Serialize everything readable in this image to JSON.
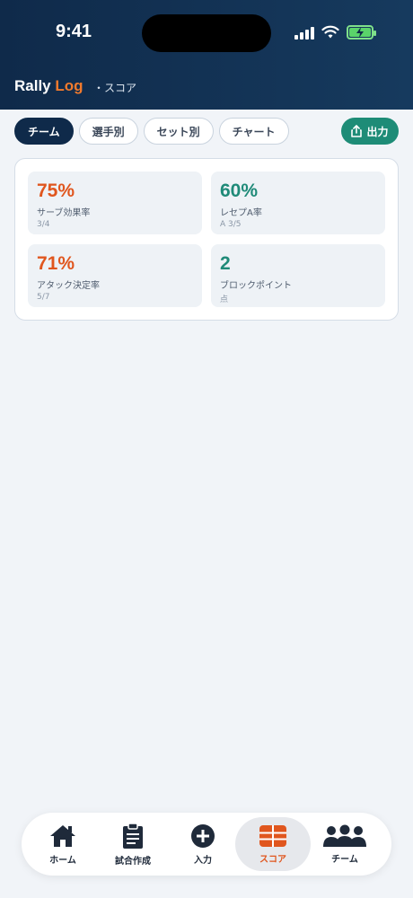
{
  "status": {
    "time": "9:41"
  },
  "app": {
    "title_part1": "Rally",
    "title_part2": "Log",
    "subtitle": "・スコア"
  },
  "tabs": [
    {
      "label": "チーム",
      "active": true
    },
    {
      "label": "選手別",
      "active": false
    },
    {
      "label": "セット別",
      "active": false
    },
    {
      "label": "チャート",
      "active": false
    }
  ],
  "export": {
    "label": "出力",
    "icon": "share-icon"
  },
  "stats": [
    {
      "value": "75%",
      "label": "サーブ効果率",
      "sub": "3/4",
      "color": "#e0561e"
    },
    {
      "value": "60%",
      "label": "レセプA率",
      "sub": "A 3/5",
      "color": "#1f8a78"
    },
    {
      "value": "71%",
      "label": "アタック決定率",
      "sub": "5/7",
      "color": "#e0561e"
    },
    {
      "value": "2",
      "label": "ブロックポイント",
      "sub": "点",
      "color": "#1f8a78"
    }
  ],
  "nav": [
    {
      "label": "ホーム",
      "icon": "home-icon",
      "active": false
    },
    {
      "label": "試合作成",
      "icon": "clipboard-icon",
      "active": false
    },
    {
      "label": "入力",
      "icon": "plus-circle-icon",
      "active": false
    },
    {
      "label": "スコア",
      "icon": "scoreboard-icon",
      "active": true
    },
    {
      "label": "チーム",
      "icon": "team-icon",
      "active": false
    }
  ],
  "colors": {
    "header": "#0f2a4a",
    "accent": "#f07a2d",
    "green": "#1e8c77"
  }
}
